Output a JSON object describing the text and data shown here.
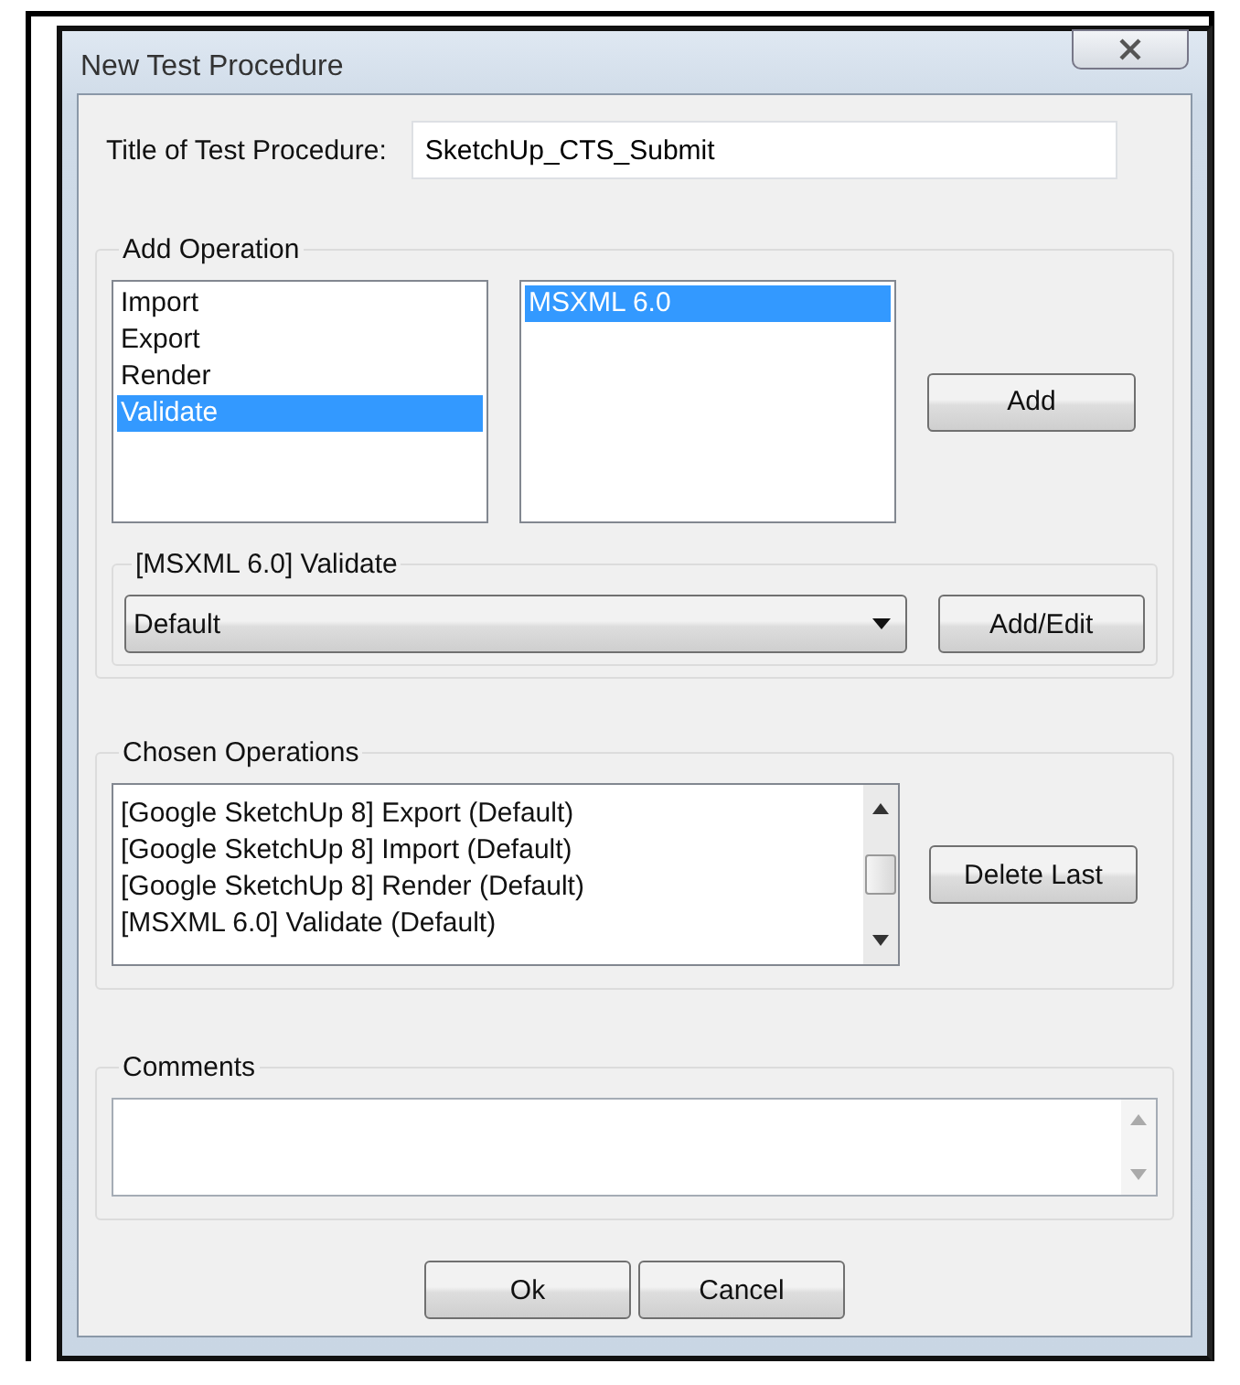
{
  "window": {
    "title": "New Test Procedure"
  },
  "title_field": {
    "label": "Title of Test Procedure:",
    "value": "SketchUp_CTS_Submit"
  },
  "add_operation": {
    "legend": "Add Operation",
    "operations": [
      {
        "label": "Import",
        "selected": false
      },
      {
        "label": "Export",
        "selected": false
      },
      {
        "label": "Render",
        "selected": false
      },
      {
        "label": "Validate",
        "selected": true
      }
    ],
    "tools": [
      {
        "label": "MSXML 6.0",
        "selected": true
      }
    ],
    "add_button": "Add",
    "settings": {
      "legend": "[MSXML 6.0] Validate",
      "value": "Default",
      "button": "Add/Edit"
    }
  },
  "chosen_operations": {
    "legend": "Chosen Operations",
    "items": [
      "[Google SketchUp 8] Export (Default)",
      "[Google SketchUp 8] Import (Default)",
      "[Google SketchUp 8] Render (Default)",
      "[MSXML 6.0] Validate (Default)"
    ],
    "button": "Delete Last"
  },
  "comments": {
    "legend": "Comments"
  },
  "buttons": [
    "Ok",
    "Cancel"
  ]
}
